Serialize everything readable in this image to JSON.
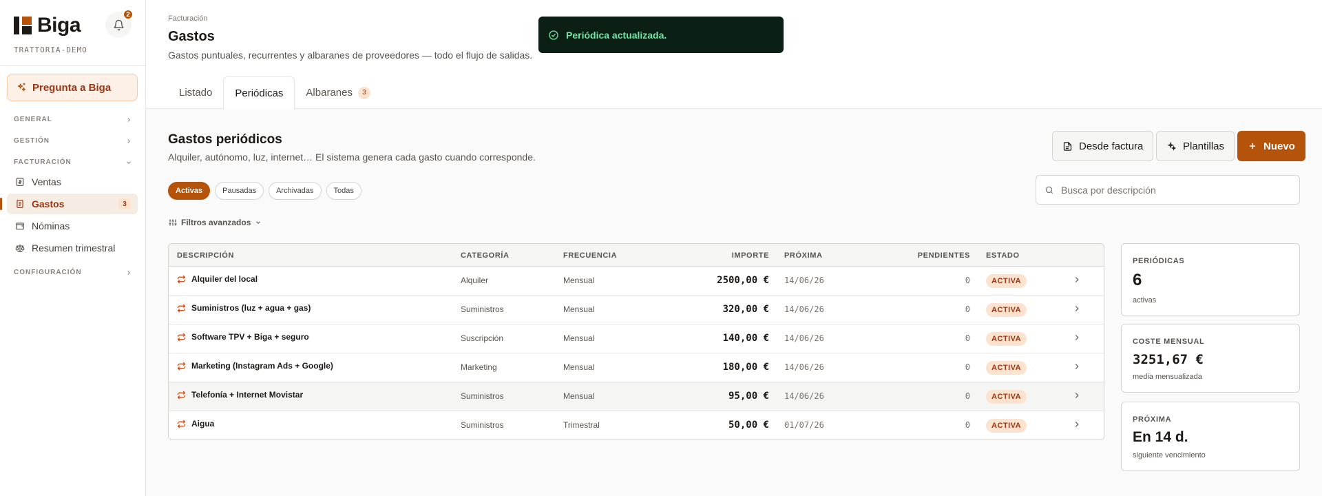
{
  "brand": {
    "name": "Biga",
    "tenant": "TRATTORIA-DEMO",
    "notifications": "2"
  },
  "sidebar": {
    "ask_label": "Pregunta a Biga",
    "sections": {
      "general": "GENERAL",
      "gestion": "GESTIÓN",
      "facturacion": "FACTURACIÓN",
      "configuracion": "CONFIGURACIÓN"
    },
    "items": [
      {
        "label": "Ventas"
      },
      {
        "label": "Gastos",
        "count": "3"
      },
      {
        "label": "Nóminas"
      },
      {
        "label": "Resumen trimestral"
      }
    ]
  },
  "header": {
    "breadcrumb": "Facturación",
    "title": "Gastos",
    "subtitle": "Gastos puntuales, recurrentes y albaranes de proveedores — todo el flujo de salidas.",
    "tabs": [
      {
        "label": "Listado"
      },
      {
        "label": "Periódicas"
      },
      {
        "label": "Albaranes",
        "count": "3"
      }
    ]
  },
  "toast": {
    "message": "Periódica actualizada."
  },
  "section": {
    "title": "Gastos periódicos",
    "subtitle": "Alquiler, autónomo, luz, internet… El sistema genera cada gasto cuando corresponde."
  },
  "actions": {
    "from_invoice": "Desde factura",
    "templates": "Plantillas",
    "new": "Nuevo"
  },
  "filters": {
    "chips": [
      "Activas",
      "Pausadas",
      "Archivadas",
      "Todas"
    ],
    "advanced": "Filtros avanzados"
  },
  "search": {
    "placeholder": "Busca por descripción",
    "value": ""
  },
  "table": {
    "columns": {
      "desc": "DESCRIPCIÓN",
      "cat": "CATEGORÍA",
      "freq": "FRECUENCIA",
      "imp": "IMPORTE",
      "next": "PRÓXIMA",
      "pend": "PENDIENTES",
      "state": "ESTADO"
    },
    "rows": [
      {
        "desc": "Alquiler del local",
        "cat": "Alquiler",
        "freq": "Mensual",
        "imp": "2500,00 €",
        "next": "14/06/26",
        "pend": "0",
        "state": "ACTIVA"
      },
      {
        "desc": "Suministros (luz + agua + gas)",
        "cat": "Suministros",
        "freq": "Mensual",
        "imp": "320,00 €",
        "next": "14/06/26",
        "pend": "0",
        "state": "ACTIVA"
      },
      {
        "desc": "Software TPV + Biga + seguro",
        "cat": "Suscripción",
        "freq": "Mensual",
        "imp": "140,00 €",
        "next": "14/06/26",
        "pend": "0",
        "state": "ACTIVA"
      },
      {
        "desc": "Marketing (Instagram Ads + Google)",
        "cat": "Marketing",
        "freq": "Mensual",
        "imp": "180,00 €",
        "next": "14/06/26",
        "pend": "0",
        "state": "ACTIVA"
      },
      {
        "desc": "Telefonía + Internet Movistar",
        "cat": "Suministros",
        "freq": "Mensual",
        "imp": "95,00 €",
        "next": "14/06/26",
        "pend": "0",
        "state": "ACTIVA"
      },
      {
        "desc": "Aigua",
        "cat": "Suministros",
        "freq": "Trimestral",
        "imp": "50,00 €",
        "next": "01/07/26",
        "pend": "0",
        "state": "ACTIVA"
      }
    ]
  },
  "stats": [
    {
      "label": "PERIÓDICAS",
      "value": "6",
      "sub": "activas"
    },
    {
      "label": "COSTE MENSUAL",
      "value": "3251,67 €",
      "sub": "media mensualizada"
    },
    {
      "label": "PRÓXIMA",
      "value": "En 14 d.",
      "sub": "siguiente vencimiento"
    }
  ],
  "colors": {
    "accent": "#b45309",
    "accent_soft": "#fbe3cf",
    "toast_bg": "#0b1f15",
    "toast_text": "#6ee7a7"
  }
}
